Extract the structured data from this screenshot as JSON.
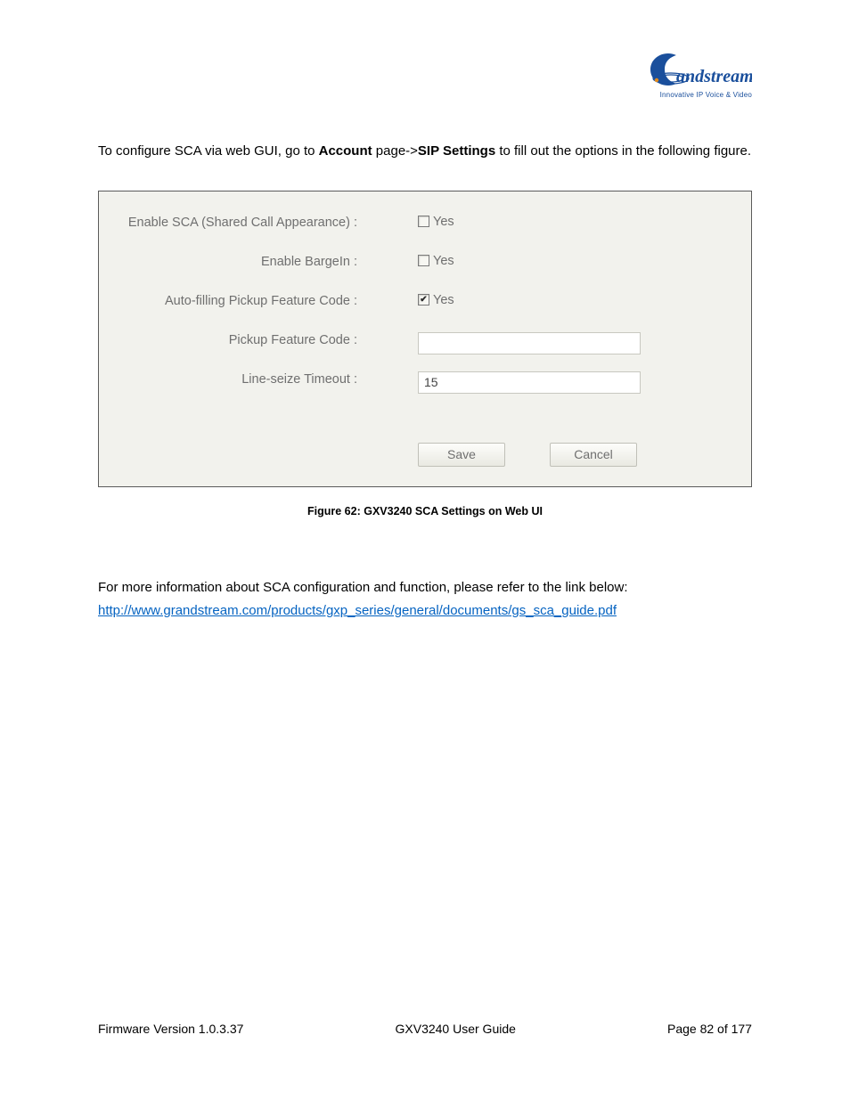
{
  "logo": {
    "brand": "Grandstream",
    "tagline": "Innovative IP Voice & Video"
  },
  "intro": {
    "pre": "To configure SCA via web GUI, go to ",
    "bold1": "Account",
    "mid": " page->",
    "bold2": "SIP Settings",
    "post": " to fill out the options in the following figure."
  },
  "form": {
    "rows": [
      {
        "label": "Enable SCA (Shared Call Appearance) :",
        "type": "checkbox",
        "checked": false,
        "text": "Yes"
      },
      {
        "label": "Enable BargeIn :",
        "type": "checkbox",
        "checked": false,
        "text": "Yes"
      },
      {
        "label": "Auto-filling Pickup Feature Code :",
        "type": "checkbox",
        "checked": true,
        "text": "Yes"
      },
      {
        "label": "Pickup Feature Code :",
        "type": "text",
        "value": ""
      },
      {
        "label": "Line-seize Timeout :",
        "type": "text",
        "value": "15"
      }
    ],
    "buttons": {
      "save": "Save",
      "cancel": "Cancel"
    }
  },
  "caption": "Figure 62: GXV3240 SCA Settings on Web UI",
  "para2": {
    "text": "For more information about SCA configuration and function, please refer to the link below:",
    "link": "http://www.grandstream.com/products/gxp_series/general/documents/gs_sca_guide.pdf"
  },
  "footer": {
    "left": "Firmware Version 1.0.3.37",
    "center": "GXV3240 User Guide",
    "right": "Page 82 of 177"
  }
}
